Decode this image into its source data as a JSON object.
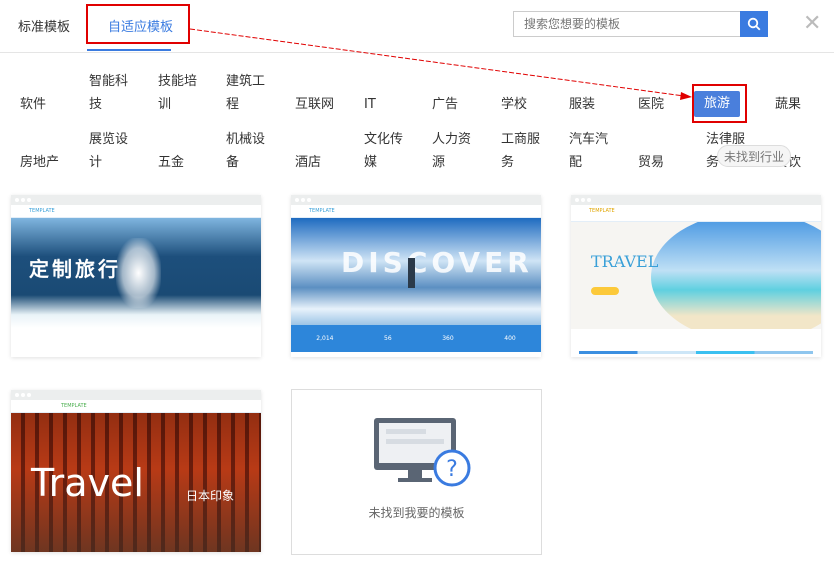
{
  "tabs": [
    {
      "label": "标准模板",
      "active": false
    },
    {
      "label": "自适应模板",
      "active": true
    }
  ],
  "search": {
    "placeholder": "搜索您想要的模板",
    "icon": "search-icon"
  },
  "close_icon": "close-icon",
  "categories": {
    "row1": [
      "软件",
      "智能科技",
      "技能培训",
      "建筑工程",
      "互联网",
      "IT",
      "广告",
      "学校",
      "服装",
      "医院",
      "旅游",
      "蔬果"
    ],
    "row2": [
      "房地产",
      "展览设计",
      "五金",
      "机械设备",
      "酒店",
      "文化传媒",
      "人力资源",
      "工商服务",
      "汽车汽配",
      "贸易",
      "法律服务",
      "餐饮"
    ],
    "active": "旅游"
  },
  "tooltip": "未找到行业",
  "templates": [
    {
      "logo": "TEMPLATE",
      "headline": "定制旅行"
    },
    {
      "logo": "TEMPLATE",
      "headline": "DISCOVER",
      "stats": [
        "2,014",
        "56",
        "360",
        "400"
      ]
    },
    {
      "logo": "TEMPLATE",
      "headline": "TRAVEL"
    },
    {
      "logo": "TEMPLATE",
      "headline": "Travel",
      "sub": "日本印象"
    }
  ],
  "placeholder": {
    "text": "未找到我要的模板"
  },
  "colors": {
    "accent": "#3a7be0",
    "annotation": "#e00000"
  }
}
